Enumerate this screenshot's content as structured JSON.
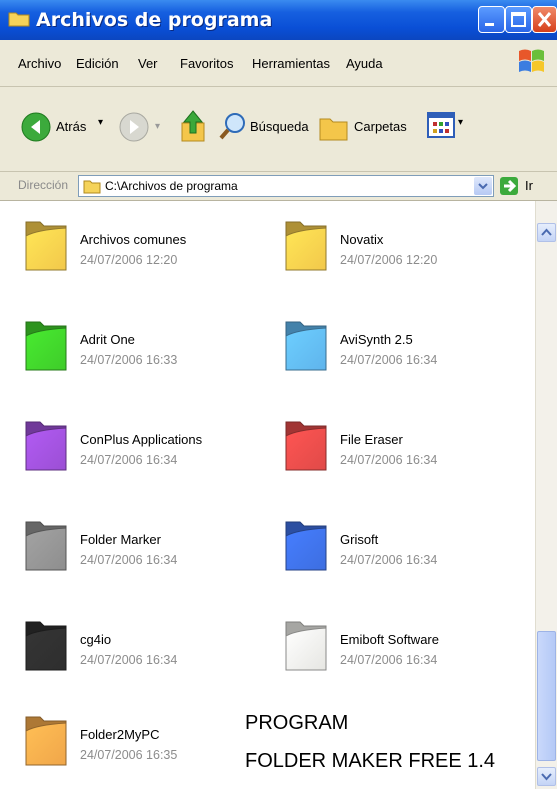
{
  "window": {
    "title": "Archivos de programa"
  },
  "menu": {
    "items": [
      "Archivo",
      "Edición",
      "Ver",
      "Favoritos",
      "Herramientas",
      "Ayuda"
    ]
  },
  "toolbar": {
    "back_label": "Atrás",
    "search_label": "Búsqueda",
    "folders_label": "Carpetas"
  },
  "address": {
    "label": "Dirección",
    "path": "C:\\Archivos de programa",
    "go_label": "Ir"
  },
  "folders": [
    {
      "name": "Archivos comunes",
      "date": "24/07/2006 12:20",
      "color": "#f2c84b"
    },
    {
      "name": "Novatix",
      "date": "24/07/2006 12:20",
      "color": "#f2c84b"
    },
    {
      "name": "Adrit One",
      "date": "24/07/2006 16:33",
      "color": "#3fcc2a"
    },
    {
      "name": "AviSynth 2.5",
      "date": "24/07/2006 16:34",
      "color": "#5fb4ec"
    },
    {
      "name": "ConPlus Applications",
      "date": "24/07/2006 16:34",
      "color": "#9b4fd4"
    },
    {
      "name": "File Eraser",
      "date": "24/07/2006 16:34",
      "color": "#e04a48"
    },
    {
      "name": "Folder Marker",
      "date": "24/07/2006 16:34",
      "color": "#8e8e8e"
    },
    {
      "name": "Grisoft",
      "date": "24/07/2006 16:34",
      "color": "#3d6ee0"
    },
    {
      "name": "cg4io",
      "date": "24/07/2006 16:34",
      "color": "#2e2e2e"
    },
    {
      "name": "Emiboft Software",
      "date": "24/07/2006 16:34",
      "color": "#e6e6e2"
    },
    {
      "name": "Folder2MyPC",
      "date": "24/07/2006 16:35",
      "color": "#f0a64a"
    }
  ],
  "caption": {
    "line1": "PROGRAM",
    "line2": "FOLDER MAKER FREE 1.4"
  }
}
